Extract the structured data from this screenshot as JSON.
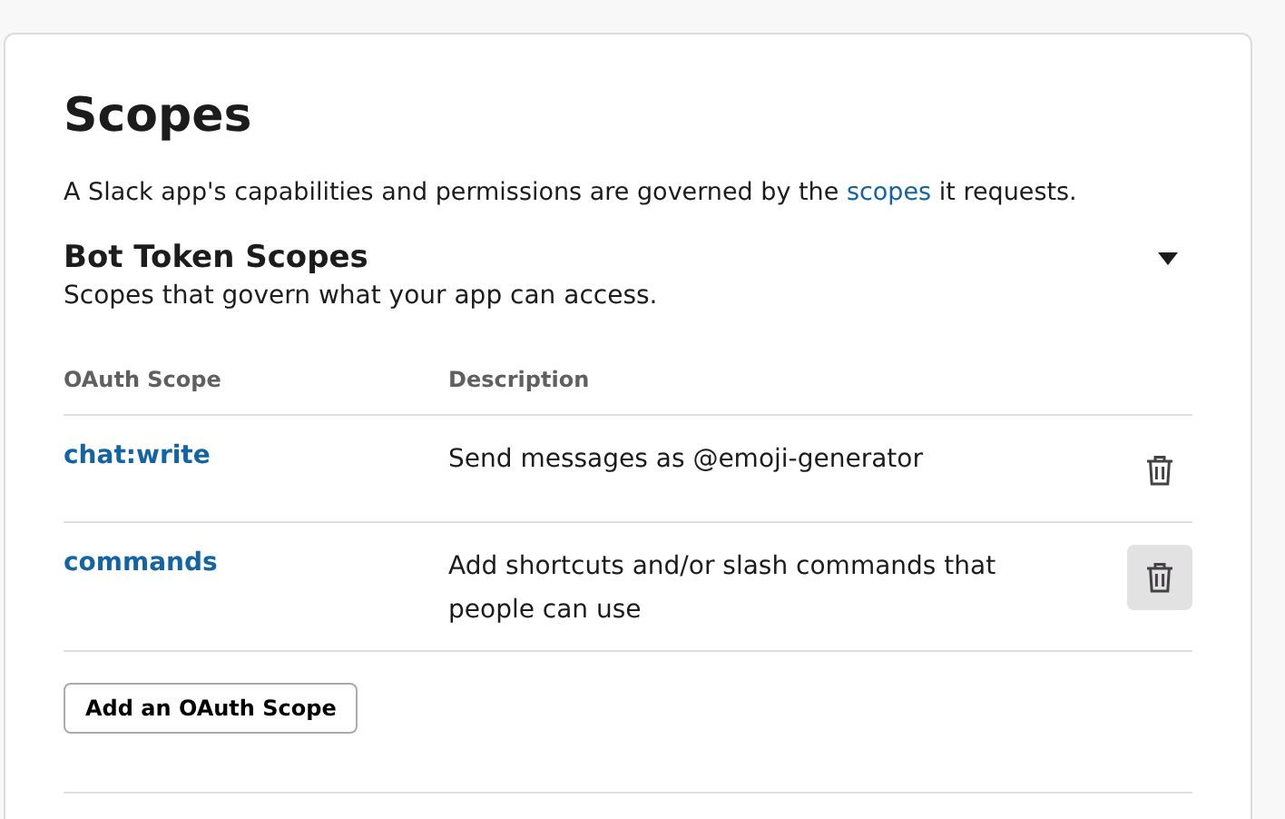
{
  "section": {
    "title": "Scopes",
    "intro": "A Slack app's capabilities and permissions are governed by the ",
    "intro_link": "scopes",
    "intro_end": " it requests."
  },
  "bot_token_scopes": {
    "title": "Bot Token Scopes",
    "expanded": true,
    "subtitle": "Scopes that govern what your app can access.",
    "columns": [
      "OAuth Scope",
      "Description"
    ],
    "rows": [
      {
        "scope": "chat:write",
        "description": "Send messages as @emoji-generator",
        "hovered": false
      },
      {
        "scope": "commands",
        "description": "Add shortcuts and/or slash commands that people can use",
        "hovered": true
      }
    ],
    "add_button": "Add an OAuth Scope"
  }
}
